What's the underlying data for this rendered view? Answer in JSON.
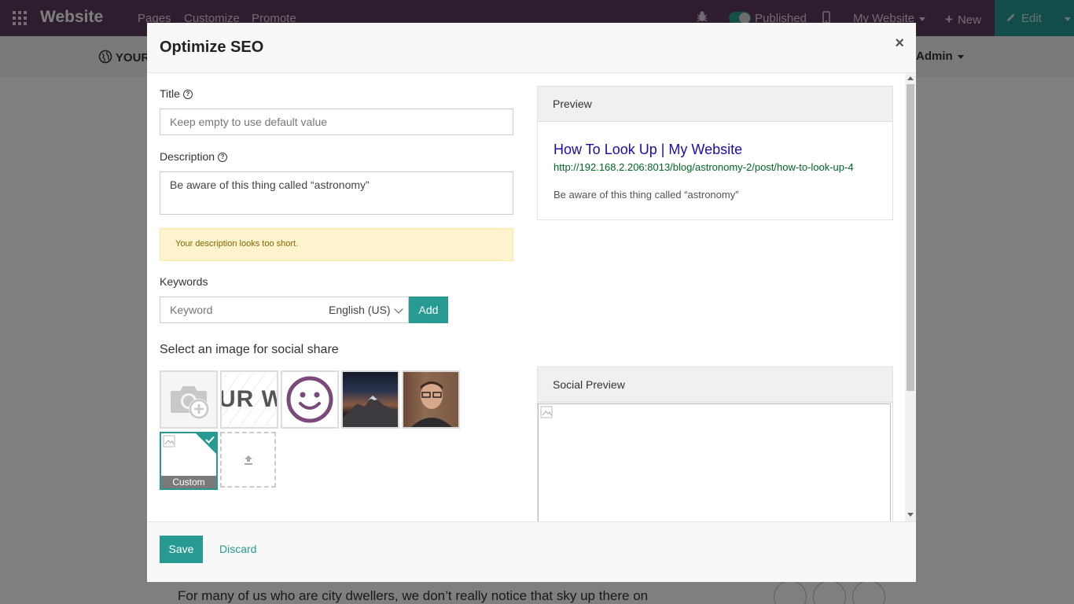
{
  "topbar": {
    "brand": "Website",
    "menu": [
      "Pages",
      "Customize",
      "Promote"
    ],
    "published_label": "Published",
    "site_selector": "My Website",
    "new_label": "New",
    "edit_label": "Edit",
    "bg_color": "#5c3a5c",
    "accent": "#279a92"
  },
  "background": {
    "logo_text": "YOUR",
    "user_menu": "Admin",
    "article_text": "For many of us who are city dwellers, we don’t really notice that sky up there on"
  },
  "modal": {
    "title": "Optimize SEO",
    "close": "×",
    "title_field": {
      "label": "Title",
      "placeholder": "Keep empty to use default value",
      "value": ""
    },
    "description_field": {
      "label": "Description",
      "value": "Be aware of this thing called “astronomy”"
    },
    "warning": "Your description looks too short.",
    "keywords": {
      "label": "Keywords",
      "placeholder": "Keyword",
      "language": "English (US)",
      "add_label": "Add"
    },
    "social_image": {
      "heading": "Select an image for social share",
      "thumbs": [
        {
          "name": "camera-add-icon"
        },
        {
          "name": "logo-text",
          "text": "UR W"
        },
        {
          "name": "smiley-icon"
        },
        {
          "name": "mountain-photo"
        },
        {
          "name": "person-photo"
        }
      ],
      "custom_label": "Custom",
      "upload_icon": "upload-icon"
    },
    "preview": {
      "heading": "Preview",
      "title": "How To Look Up | My Website",
      "url": "http://192.168.2.206:8013/blog/astronomy-2/post/how-to-look-up-4",
      "description": "Be aware of this thing called “astronomy”"
    },
    "social_preview": {
      "heading": "Social Preview"
    },
    "footer": {
      "save_label": "Save",
      "discard_label": "Discard"
    }
  }
}
